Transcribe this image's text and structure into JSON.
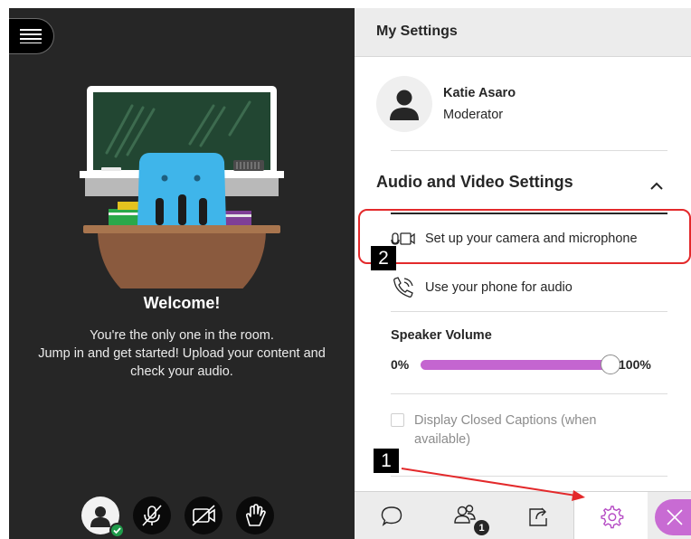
{
  "stage": {
    "welcome_title": "Welcome!",
    "welcome_lines": [
      "You're the only one in the room.",
      "Jump in and get started! Upload your content and",
      "check your audio."
    ],
    "controls": [
      "avatar-icon",
      "microphone-muted-icon",
      "camera-off-icon",
      "raise-hand-icon"
    ]
  },
  "panel": {
    "title": "My Settings",
    "user": {
      "name": "Katie Asaro",
      "role": "Moderator"
    },
    "audio_video": {
      "title": "Audio and Video Settings",
      "setup_label": "Set up your camera and microphone",
      "phone_label": "Use your phone for audio",
      "volume_label": "Speaker Volume",
      "volume_min": "0%",
      "volume_max": "100%",
      "volume_level": 1.0,
      "captions_label": "Display Closed Captions (when available)",
      "captions_checked": false
    },
    "tabs": [
      "chat-icon",
      "attendees-icon",
      "share-content-icon",
      "settings-icon"
    ],
    "attendee_count": "1",
    "active_tab": "settings"
  },
  "annotations": {
    "callout_1": "1",
    "callout_2": "2",
    "highlight_color": "#e3292b"
  },
  "colors": {
    "accent": "#c465d0",
    "stage_bg": "#262626",
    "panel_header_bg": "#ececec"
  }
}
